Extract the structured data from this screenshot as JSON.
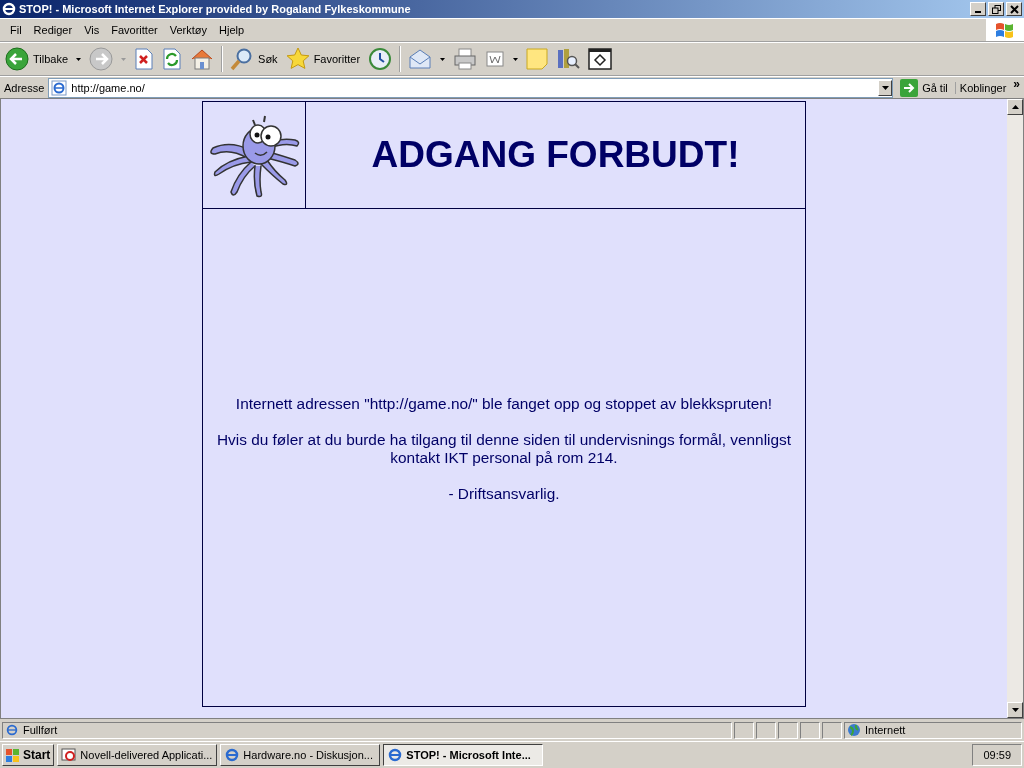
{
  "window": {
    "title": "STOP! - Microsoft Internet Explorer provided by Rogaland Fylkeskommune"
  },
  "menu": [
    "Fil",
    "Rediger",
    "Vis",
    "Favoritter",
    "Verktøy",
    "Hjelp"
  ],
  "toolbar": [
    {
      "kind": "back",
      "label": "Tilbake",
      "disabled": false
    },
    {
      "kind": "forward",
      "disabled": true
    },
    {
      "kind": "stop"
    },
    {
      "kind": "refresh"
    },
    {
      "kind": "home"
    },
    {
      "kind": "separator"
    },
    {
      "kind": "search",
      "label": "Søk"
    },
    {
      "kind": "favorites",
      "label": "Favoritter"
    },
    {
      "kind": "history"
    },
    {
      "kind": "separator"
    },
    {
      "kind": "mail"
    },
    {
      "kind": "print"
    },
    {
      "kind": "edit"
    },
    {
      "kind": "note"
    },
    {
      "kind": "research"
    },
    {
      "kind": "messenger"
    }
  ],
  "address": {
    "label": "Adresse",
    "value": "http://game.no/",
    "go": "Gå til",
    "links": "Koblinger",
    "more": "»"
  },
  "page": {
    "heading": "ADGANG FORBUDT!",
    "paragraphs": [
      "Internett adressen \"http://game.no/\" ble fanget opp og stoppet av blekkspruten!",
      "Hvis du føler at du burde ha tilgang til denne siden til undervisnings formål, vennligst kontakt IKT personal på rom 214.",
      "- Driftsansvarlig."
    ]
  },
  "status_bar": {
    "text": "Fullført",
    "zone": "Internett"
  },
  "taskbar": {
    "start": "Start",
    "tasks": [
      {
        "label": "Novell-delivered Applicati...",
        "kind": "novell",
        "selected": false
      },
      {
        "label": "Hardware.no - Diskusjon...",
        "kind": "ie",
        "selected": false
      },
      {
        "label": "STOP! - Microsoft Inte...",
        "kind": "ie",
        "selected": true
      }
    ],
    "clock": "09:59"
  }
}
